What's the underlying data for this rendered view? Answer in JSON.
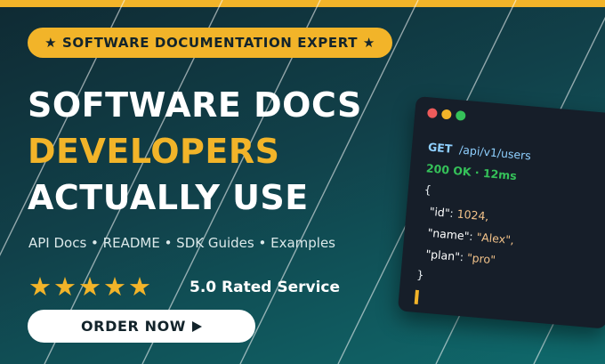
{
  "colors": {
    "accent": "#f2b429",
    "background": "#11414a",
    "code_bg": "#161e29",
    "status_green": "#35c259",
    "method_blue": "#8fd0ff"
  },
  "badge": {
    "text": "★ SOFTWARE DOCUMENTATION EXPERT ★"
  },
  "headline": {
    "line1": "SOFTWARE DOCS",
    "line2": "DEVELOPERS",
    "line3": "ACTUALLY USE"
  },
  "services": "API Docs • README • SDK Guides • Examples",
  "rating": {
    "stars": 5,
    "max_stars": 5,
    "text": "5.0 Rated Service"
  },
  "cta": {
    "label": "ORDER NOW",
    "icon": "play-triangle-icon"
  },
  "code_window": {
    "method": "GET",
    "path": "/api/v1/users",
    "status": "200 OK · 12ms",
    "open_brace": "{",
    "fields": [
      {
        "key": "\"id\"",
        "value": "1024,"
      },
      {
        "key": "\"name\"",
        "value": "\"Alex\","
      },
      {
        "key": "\"plan\"",
        "value": "\"pro\""
      }
    ],
    "close_brace": "}"
  }
}
